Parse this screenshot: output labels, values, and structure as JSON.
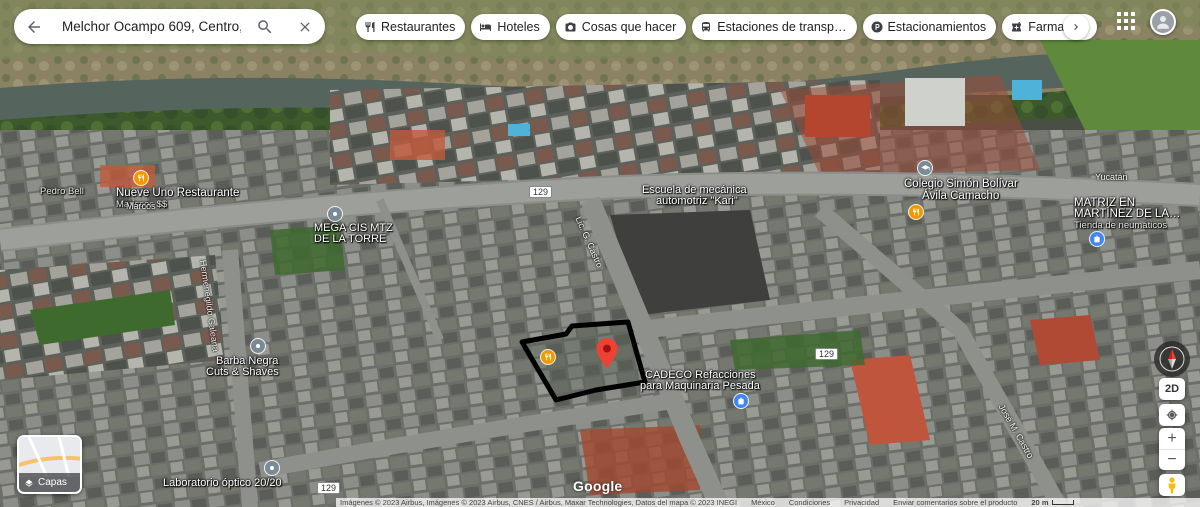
{
  "search": {
    "value": "Melchor Ocampo 609, Centro, (",
    "back_icon": "arrow-left-icon",
    "search_icon": "search-icon",
    "clear_icon": "close-icon"
  },
  "chips": [
    {
      "label": "Restaurantes",
      "icon": "restaurant-icon"
    },
    {
      "label": "Hoteles",
      "icon": "hotel-icon"
    },
    {
      "label": "Cosas que hacer",
      "icon": "camera-icon"
    },
    {
      "label": "Estaciones de transp…",
      "icon": "bus-icon"
    },
    {
      "label": "Estacionamientos",
      "icon": "parking-icon"
    },
    {
      "label": "Farmacias",
      "icon": "pharmacy-icon"
    }
  ],
  "places": {
    "nueve_uno": "Nueve Uno Restaurante",
    "nueve_uno_sub": "Mariscos $$",
    "pedro_bell": "Pedro Bell",
    "mega_cis_1": "MEGA CIS MTZ",
    "mega_cis_2": "DE LA TORRE",
    "escuela_1": "Escuela de mecánica",
    "escuela_2": "automotriz \"Kari\"",
    "colegio_1": "Colegio Simón Bolívar",
    "colegio_2": "Ávila Camacho",
    "yucatan": "Yucatán",
    "matriz_1": "MATRIZ EN",
    "matriz_2": "MARTÍNEZ DE LA…",
    "matriz_sub": "Tienda de neumáticos",
    "barba_1": "Barba Negra",
    "barba_2": "Cuts & Shaves",
    "cadeco_1": "CADECO Refacciones",
    "cadeco_2": "para Maquinaria Pesada",
    "laboratorio": "Laboratorio óptico 20/20"
  },
  "streets": {
    "hermenegildo": "Hermenegildo Galeana",
    "lic_castro": "Lic. G. Castro",
    "jose_castro": "José M. Castro",
    "marcos": "Marcos"
  },
  "road_badges": [
    "129",
    "129",
    "129"
  ],
  "controls": {
    "layers_label": "Capas",
    "view_2d": "2D",
    "zoom_in": "+",
    "zoom_out": "−"
  },
  "footer": {
    "logo": "Google",
    "imagery": "Imágenes © 2023 Airbus, Imágenes © 2023 Airbus, CNES / Airbus, Maxar Technologies, Datos del mapa © 2023 INEGI",
    "country": "México",
    "terms": "Condiciones",
    "privacy": "Privacidad",
    "feedback": "Enviar comentarios sobre el producto",
    "scale": "20 m"
  },
  "colors": {
    "pin": "#ea4335",
    "restaurant_poi": "#f29900",
    "blue_poi": "#4285f4",
    "gray_poi": "#7b8b93",
    "outline": "#000000"
  }
}
